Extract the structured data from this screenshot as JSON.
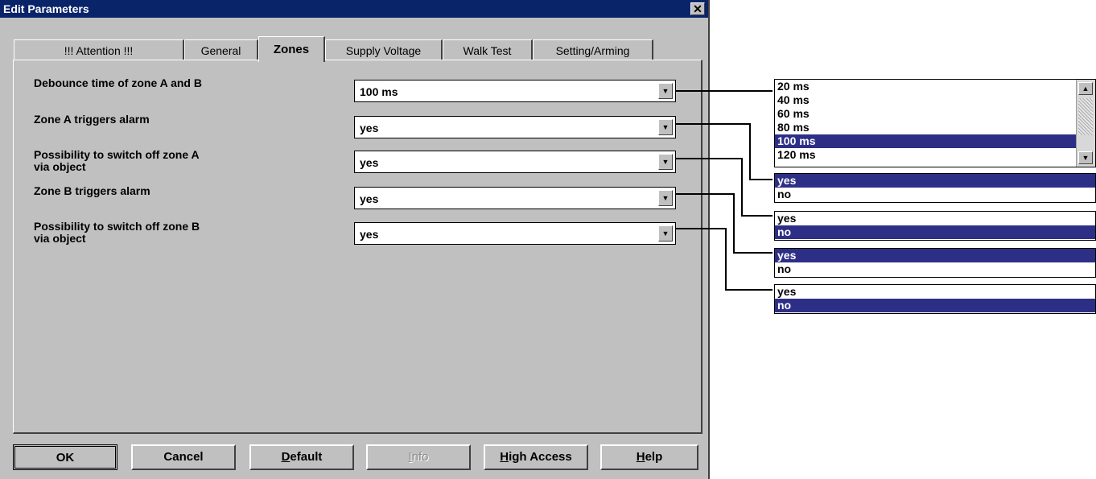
{
  "window": {
    "title": "Edit Parameters",
    "close_glyph": "✕"
  },
  "tabs": [
    {
      "label": "!!! Attention !!!"
    },
    {
      "label": "General"
    },
    {
      "label": "Zones"
    },
    {
      "label": "Supply Voltage"
    },
    {
      "label": "Walk Test"
    },
    {
      "label": "Setting/Arming"
    }
  ],
  "active_tab": "Zones",
  "params": [
    {
      "label": "Debounce time of zone A and B",
      "value": "100 ms"
    },
    {
      "label": "Zone A triggers alarm",
      "value": "yes"
    },
    {
      "label": "Possibility to switch off zone A\nvia object",
      "value": "yes"
    },
    {
      "label": "Zone B triggers alarm",
      "value": "yes"
    },
    {
      "label": "Possibility to switch off zone B\nvia object",
      "value": "yes"
    }
  ],
  "dropdown_arrow": "▼",
  "buttons": {
    "ok": "OK",
    "cancel": "Cancel",
    "default_pre": "",
    "default_ul": "D",
    "default_post": "efault",
    "info_pre": "",
    "info_ul": "I",
    "info_post": "nfo",
    "high_pre": "",
    "high_ul": "H",
    "high_post": "igh Access",
    "help_pre": "",
    "help_ul": "H",
    "help_post": "elp"
  },
  "option_lists": [
    {
      "options": [
        "20 ms",
        "40 ms",
        "60 ms",
        "80 ms",
        "100 ms",
        "120 ms"
      ],
      "selected": "100 ms",
      "scroll_up": "▲",
      "scroll_down": "▼"
    },
    {
      "options": [
        "yes",
        "no"
      ],
      "selected": "yes"
    },
    {
      "options": [
        "yes",
        "no"
      ],
      "selected": "no"
    },
    {
      "options": [
        "yes",
        "no"
      ],
      "selected": "yes"
    },
    {
      "options": [
        "yes",
        "no"
      ],
      "selected": "no"
    }
  ],
  "colors": {
    "title_bar": "#0a246a",
    "selection": "#2d2f86",
    "face": "#c0c0c0"
  }
}
